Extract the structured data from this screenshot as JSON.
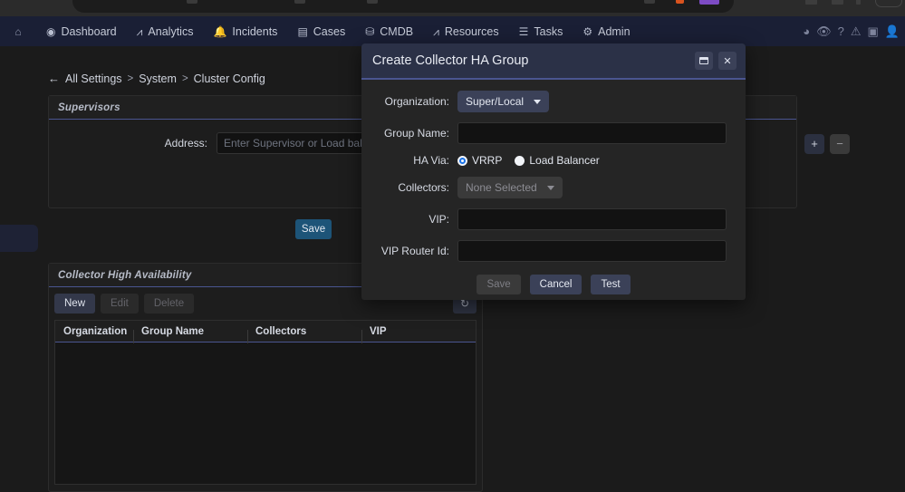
{
  "browser": {
    "tab_strip_visible": true
  },
  "topnav": {
    "home_icon": "home-icon",
    "items": [
      {
        "label": "Dashboard",
        "icon": "gauge-icon",
        "icon_glyph": "◉"
      },
      {
        "label": "Analytics",
        "icon": "bar-chart-icon",
        "icon_glyph": "⛰"
      },
      {
        "label": "Incidents",
        "icon": "bell-icon",
        "icon_glyph": "🔔"
      },
      {
        "label": "Cases",
        "icon": "folder-icon",
        "icon_glyph": "▤"
      },
      {
        "label": "CMDB",
        "icon": "database-icon",
        "icon_glyph": "▤"
      },
      {
        "label": "Resources",
        "icon": "chart-icon",
        "icon_glyph": "⛰"
      },
      {
        "label": "Tasks",
        "icon": "list-icon",
        "icon_glyph": "≔"
      },
      {
        "label": "Admin",
        "icon": "gears-icon",
        "icon_glyph": "⚙"
      }
    ],
    "right_icons": [
      {
        "name": "palette-icon",
        "glyph": "◕"
      },
      {
        "name": "eye-monitor-icon",
        "glyph": "👁"
      },
      {
        "name": "help-icon",
        "glyph": "?"
      },
      {
        "name": "warning-icon",
        "glyph": "⚠"
      },
      {
        "name": "id-card-icon",
        "glyph": "▣"
      },
      {
        "name": "user-avatar-icon",
        "glyph": "👤"
      }
    ]
  },
  "breadcrumb": {
    "back_arrow": "←",
    "root": "All Settings",
    "sep": ">",
    "parts": [
      "System",
      "Cluster Config"
    ]
  },
  "supervisors": {
    "title": "Supervisors",
    "address_label": "Address:",
    "address_value": "",
    "address_placeholder": "Enter Supervisor or Load balancer IP or Hos",
    "add_label": "+",
    "remove_label": "−",
    "save_label": "Save"
  },
  "collector_ha": {
    "title": "Collector High Availability",
    "toolbar": {
      "new_label": "New",
      "edit_label": "Edit",
      "delete_label": "Delete",
      "refresh_label": "↻"
    },
    "columns": [
      "Organization",
      "Group Name",
      "Collectors",
      "VIP"
    ],
    "rows": []
  },
  "occluded_refresh_label": "↻",
  "modal": {
    "title": "Create Collector HA Group",
    "restore_label": "restore-window-icon",
    "close_label": "✕",
    "fields": {
      "organization_label": "Organization:",
      "organization_value": "Super/Local",
      "group_name_label": "Group Name:",
      "group_name_value": "",
      "ha_via_label": "HA Via:",
      "ha_via_options": [
        "VRRP",
        "Load Balancer"
      ],
      "ha_via_selected": "VRRP",
      "collectors_label": "Collectors:",
      "collectors_value": "None Selected",
      "vip_label": "VIP:",
      "vip_value": "",
      "vip_router_id_label": "VIP Router Id:",
      "vip_router_id_value": ""
    },
    "actions": {
      "save_label": "Save",
      "cancel_label": "Cancel",
      "test_label": "Test"
    }
  },
  "colors": {
    "nav_bg": "#1a1f35",
    "page_bg": "#1b1b1b",
    "panel_bg": "#1d1d1d",
    "accent_underline": "#4a5590",
    "modal_header_bg": "#2b3147",
    "modal_body_bg": "#252525",
    "primary_button": "#3b4158",
    "save_button": "#1d5478",
    "radio_selected": "#1a73e8"
  }
}
